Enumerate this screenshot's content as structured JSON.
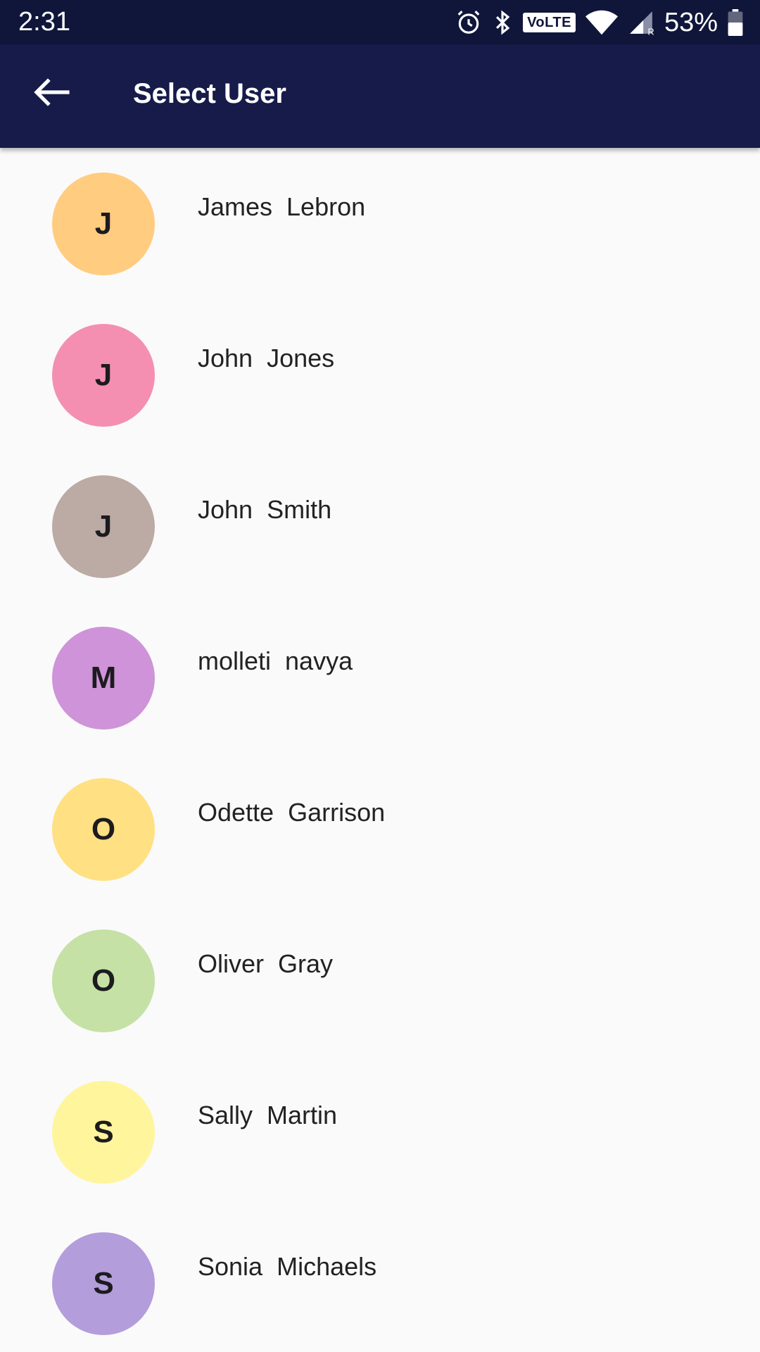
{
  "status_bar": {
    "time": "2:31",
    "volte_label": "VoLTE",
    "battery_percent": "53%",
    "icons": [
      "alarm-icon",
      "bluetooth-icon",
      "volte-icon",
      "wifi-icon",
      "signal-icon",
      "battery-icon"
    ]
  },
  "app_bar": {
    "title": "Select User",
    "back_icon": "arrow-left-icon",
    "background": "#161b4a"
  },
  "users": [
    {
      "initial": "J",
      "name": "James  Lebron",
      "color": "#ffcc80"
    },
    {
      "initial": "J",
      "name": "John  Jones",
      "color": "#f48fb1"
    },
    {
      "initial": "J",
      "name": "John  Smith",
      "color": "#bcaaa4"
    },
    {
      "initial": "M",
      "name": "molleti  navya",
      "color": "#ce93d8"
    },
    {
      "initial": "O",
      "name": "Odette  Garrison",
      "color": "#ffe082"
    },
    {
      "initial": "O",
      "name": "Oliver  Gray",
      "color": "#c5e1a5"
    },
    {
      "initial": "S",
      "name": "Sally  Martin",
      "color": "#fff59d"
    },
    {
      "initial": "S",
      "name": "Sonia  Michaels",
      "color": "#b39ddb"
    }
  ]
}
